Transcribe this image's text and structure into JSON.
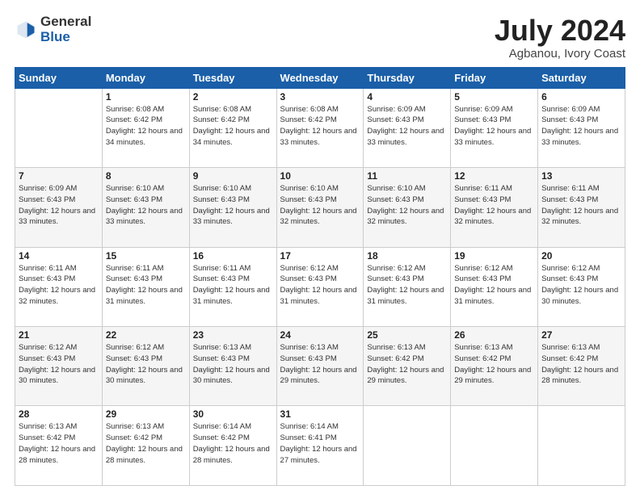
{
  "header": {
    "logo_general": "General",
    "logo_blue": "Blue",
    "title": "July 2024",
    "location": "Agbanou, Ivory Coast"
  },
  "weekdays": [
    "Sunday",
    "Monday",
    "Tuesday",
    "Wednesday",
    "Thursday",
    "Friday",
    "Saturday"
  ],
  "weeks": [
    [
      {
        "day": "",
        "sunrise": "",
        "sunset": "",
        "daylight": ""
      },
      {
        "day": "1",
        "sunrise": "6:08 AM",
        "sunset": "6:42 PM",
        "daylight": "12 hours and 34 minutes."
      },
      {
        "day": "2",
        "sunrise": "6:08 AM",
        "sunset": "6:42 PM",
        "daylight": "12 hours and 34 minutes."
      },
      {
        "day": "3",
        "sunrise": "6:08 AM",
        "sunset": "6:42 PM",
        "daylight": "12 hours and 33 minutes."
      },
      {
        "day": "4",
        "sunrise": "6:09 AM",
        "sunset": "6:43 PM",
        "daylight": "12 hours and 33 minutes."
      },
      {
        "day": "5",
        "sunrise": "6:09 AM",
        "sunset": "6:43 PM",
        "daylight": "12 hours and 33 minutes."
      },
      {
        "day": "6",
        "sunrise": "6:09 AM",
        "sunset": "6:43 PM",
        "daylight": "12 hours and 33 minutes."
      }
    ],
    [
      {
        "day": "7",
        "sunrise": "6:09 AM",
        "sunset": "6:43 PM",
        "daylight": "12 hours and 33 minutes."
      },
      {
        "day": "8",
        "sunrise": "6:10 AM",
        "sunset": "6:43 PM",
        "daylight": "12 hours and 33 minutes."
      },
      {
        "day": "9",
        "sunrise": "6:10 AM",
        "sunset": "6:43 PM",
        "daylight": "12 hours and 33 minutes."
      },
      {
        "day": "10",
        "sunrise": "6:10 AM",
        "sunset": "6:43 PM",
        "daylight": "12 hours and 32 minutes."
      },
      {
        "day": "11",
        "sunrise": "6:10 AM",
        "sunset": "6:43 PM",
        "daylight": "12 hours and 32 minutes."
      },
      {
        "day": "12",
        "sunrise": "6:11 AM",
        "sunset": "6:43 PM",
        "daylight": "12 hours and 32 minutes."
      },
      {
        "day": "13",
        "sunrise": "6:11 AM",
        "sunset": "6:43 PM",
        "daylight": "12 hours and 32 minutes."
      }
    ],
    [
      {
        "day": "14",
        "sunrise": "6:11 AM",
        "sunset": "6:43 PM",
        "daylight": "12 hours and 32 minutes."
      },
      {
        "day": "15",
        "sunrise": "6:11 AM",
        "sunset": "6:43 PM",
        "daylight": "12 hours and 31 minutes."
      },
      {
        "day": "16",
        "sunrise": "6:11 AM",
        "sunset": "6:43 PM",
        "daylight": "12 hours and 31 minutes."
      },
      {
        "day": "17",
        "sunrise": "6:12 AM",
        "sunset": "6:43 PM",
        "daylight": "12 hours and 31 minutes."
      },
      {
        "day": "18",
        "sunrise": "6:12 AM",
        "sunset": "6:43 PM",
        "daylight": "12 hours and 31 minutes."
      },
      {
        "day": "19",
        "sunrise": "6:12 AM",
        "sunset": "6:43 PM",
        "daylight": "12 hours and 31 minutes."
      },
      {
        "day": "20",
        "sunrise": "6:12 AM",
        "sunset": "6:43 PM",
        "daylight": "12 hours and 30 minutes."
      }
    ],
    [
      {
        "day": "21",
        "sunrise": "6:12 AM",
        "sunset": "6:43 PM",
        "daylight": "12 hours and 30 minutes."
      },
      {
        "day": "22",
        "sunrise": "6:12 AM",
        "sunset": "6:43 PM",
        "daylight": "12 hours and 30 minutes."
      },
      {
        "day": "23",
        "sunrise": "6:13 AM",
        "sunset": "6:43 PM",
        "daylight": "12 hours and 30 minutes."
      },
      {
        "day": "24",
        "sunrise": "6:13 AM",
        "sunset": "6:43 PM",
        "daylight": "12 hours and 29 minutes."
      },
      {
        "day": "25",
        "sunrise": "6:13 AM",
        "sunset": "6:42 PM",
        "daylight": "12 hours and 29 minutes."
      },
      {
        "day": "26",
        "sunrise": "6:13 AM",
        "sunset": "6:42 PM",
        "daylight": "12 hours and 29 minutes."
      },
      {
        "day": "27",
        "sunrise": "6:13 AM",
        "sunset": "6:42 PM",
        "daylight": "12 hours and 28 minutes."
      }
    ],
    [
      {
        "day": "28",
        "sunrise": "6:13 AM",
        "sunset": "6:42 PM",
        "daylight": "12 hours and 28 minutes."
      },
      {
        "day": "29",
        "sunrise": "6:13 AM",
        "sunset": "6:42 PM",
        "daylight": "12 hours and 28 minutes."
      },
      {
        "day": "30",
        "sunrise": "6:14 AM",
        "sunset": "6:42 PM",
        "daylight": "12 hours and 28 minutes."
      },
      {
        "day": "31",
        "sunrise": "6:14 AM",
        "sunset": "6:41 PM",
        "daylight": "12 hours and 27 minutes."
      },
      {
        "day": "",
        "sunrise": "",
        "sunset": "",
        "daylight": ""
      },
      {
        "day": "",
        "sunrise": "",
        "sunset": "",
        "daylight": ""
      },
      {
        "day": "",
        "sunrise": "",
        "sunset": "",
        "daylight": ""
      }
    ]
  ]
}
